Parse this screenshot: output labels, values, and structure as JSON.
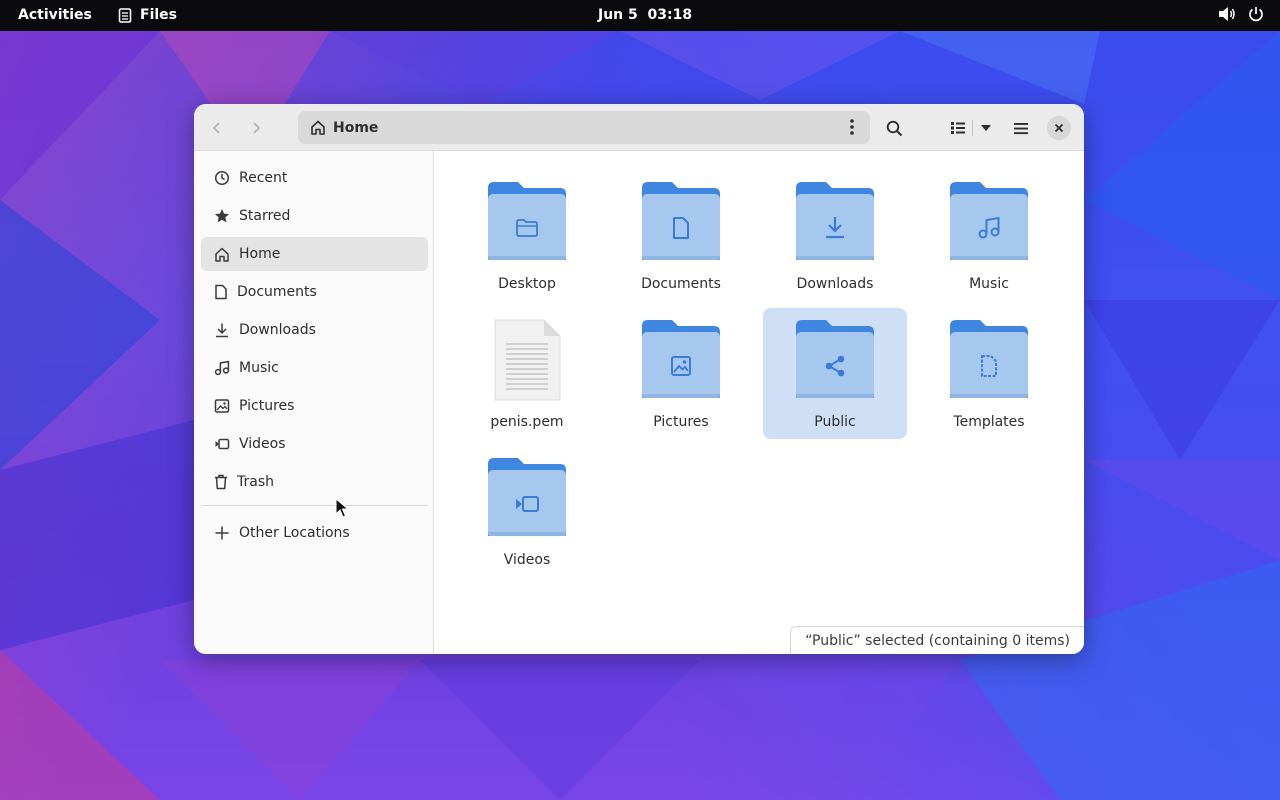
{
  "topbar": {
    "activities": "Activities",
    "app_name": "Files",
    "date": "Jun 5",
    "time": "03:18",
    "icons": [
      "notes-icon",
      "volume-icon",
      "power-icon"
    ]
  },
  "window": {
    "title": "Home",
    "nav": {
      "back_icon": "chevron-left-icon",
      "forward_icon": "chevron-right-icon"
    },
    "toolbar_icons": [
      "kebab-menu-icon",
      "search-icon",
      "list-view-icon",
      "dropdown-arrow-icon",
      "hamburger-menu-icon",
      "close-icon"
    ]
  },
  "sidebar": {
    "items": [
      {
        "label": "Recent",
        "icon": "clock-icon"
      },
      {
        "label": "Starred",
        "icon": "star-icon"
      },
      {
        "label": "Home",
        "icon": "home-icon",
        "active": true
      },
      {
        "label": "Documents",
        "icon": "document-icon"
      },
      {
        "label": "Downloads",
        "icon": "download-icon"
      },
      {
        "label": "Music",
        "icon": "music-icon"
      },
      {
        "label": "Pictures",
        "icon": "picture-icon"
      },
      {
        "label": "Videos",
        "icon": "video-icon"
      },
      {
        "label": "Trash",
        "icon": "trash-icon"
      }
    ],
    "other_locations": {
      "label": "Other Locations",
      "icon": "plus-icon"
    }
  },
  "files": [
    {
      "name": "Desktop",
      "type": "folder",
      "emblem": "folder-icon"
    },
    {
      "name": "Documents",
      "type": "folder",
      "emblem": "document-icon"
    },
    {
      "name": "Downloads",
      "type": "folder",
      "emblem": "download-icon"
    },
    {
      "name": "Music",
      "type": "folder",
      "emblem": "music-icon"
    },
    {
      "name": "penis.pem",
      "type": "file",
      "emblem": "text-file-icon"
    },
    {
      "name": "Pictures",
      "type": "folder",
      "emblem": "picture-icon"
    },
    {
      "name": "Public",
      "type": "folder",
      "emblem": "share-icon",
      "selected": true
    },
    {
      "name": "Templates",
      "type": "folder",
      "emblem": "template-icon"
    },
    {
      "name": "Videos",
      "type": "folder",
      "emblem": "video-icon"
    }
  ],
  "status": "“Public” selected  (containing 0 items)",
  "colors": {
    "folder_back": "#3f86e0",
    "folder_front": "#a6c8ef",
    "folder_emblem": "#3a7bd5",
    "selection": "#cfe0f6",
    "topbar": "#0b0b0d"
  }
}
